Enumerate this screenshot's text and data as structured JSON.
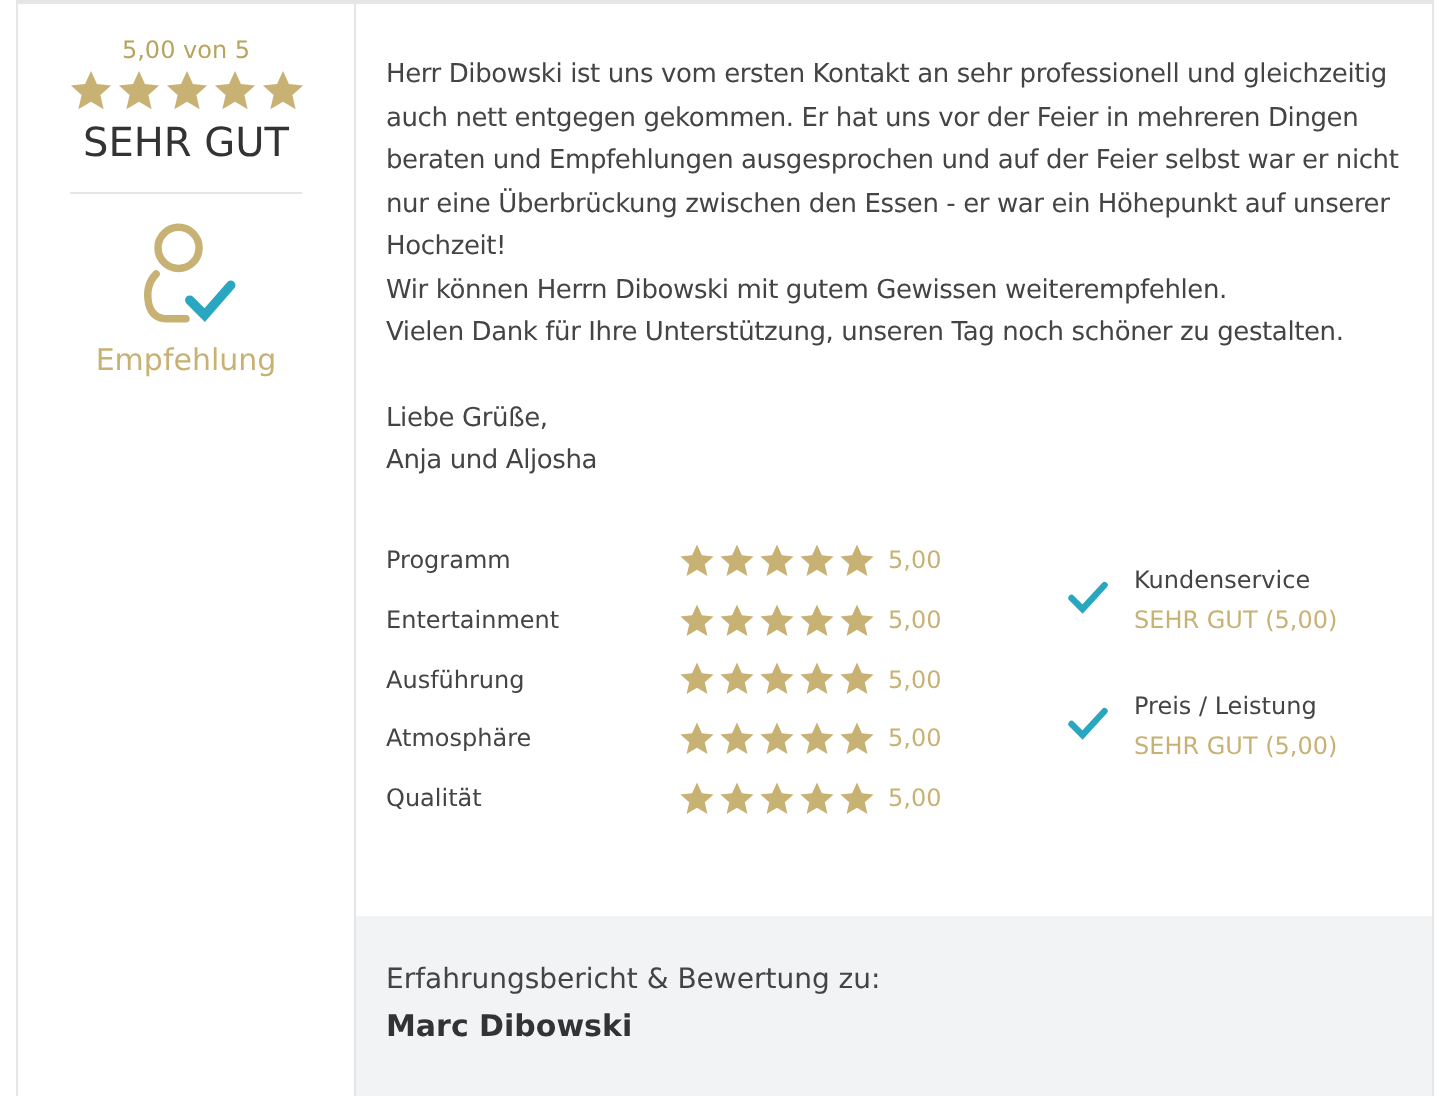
{
  "summary": {
    "score": "5,00 von 5",
    "stars": 5,
    "verdict": "SEHR GUT",
    "badge": "Empfehlung"
  },
  "review": {
    "paragraphs": [
      "Herr Dibowski ist uns vom ersten Kontakt an sehr professionell und gleichzeitig auch nett entgegen gekommen. Er hat uns vor der Feier in mehreren Dingen beraten und Empfehlungen ausgesprochen und auf der Feier selbst war er nicht nur eine Überbrückung zwischen den Essen - er war ein Höhepunkt auf unserer Hochzeit!",
      "Wir können Herrn Dibowski mit gutem Gewissen weiterempfehlen.",
      "Vielen Dank für Ihre Unterstützung, unseren Tag noch schöner zu gestalten."
    ],
    "signature": [
      "Liebe Grüße,",
      "Anja und Aljosha"
    ]
  },
  "ratings": [
    {
      "label": "Programm",
      "stars": 5,
      "value": "5,00"
    },
    {
      "label": "Entertainment",
      "stars": 5,
      "value": "5,00"
    },
    {
      "label": "Ausführung",
      "stars": 5,
      "value": "5,00"
    },
    {
      "label": "Atmosphäre",
      "stars": 5,
      "value": "5,00"
    },
    {
      "label": "Qualität",
      "stars": 5,
      "value": "5,00"
    }
  ],
  "highlights": [
    {
      "label": "Kundenservice",
      "value": "SEHR GUT (5,00)"
    },
    {
      "label": "Preis / Leistung",
      "value": "SEHR GUT (5,00)"
    }
  ],
  "footer": {
    "caption": "Erfahrungsbericht & Bewertung zu:",
    "name": "Marc Dibowski"
  }
}
